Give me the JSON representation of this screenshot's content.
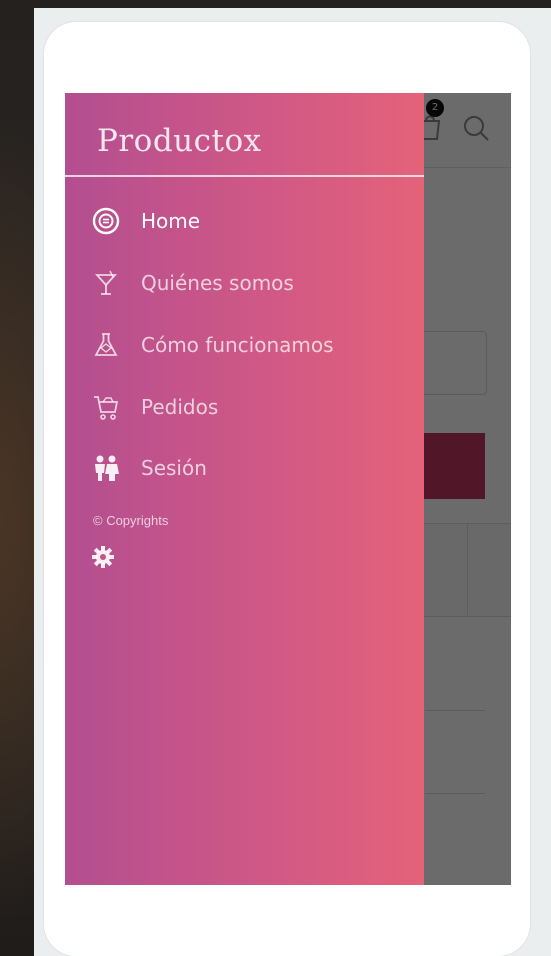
{
  "app": {
    "title": "Productox",
    "cart_count": "2"
  },
  "drawer": {
    "items": [
      {
        "label": "Home",
        "icon": "home-circle-icon",
        "active": true
      },
      {
        "label": "Quiénes somos",
        "icon": "cocktail-glass-icon",
        "active": false
      },
      {
        "label": "Cómo funcionamos",
        "icon": "flask-icon",
        "active": false
      },
      {
        "label": "Pedidos",
        "icon": "shopping-cart-icon",
        "active": false
      },
      {
        "label": "Sesión",
        "icon": "couple-icon",
        "active": false
      }
    ],
    "copyright": "© Copyrights",
    "settings_icon": "gear-icon"
  },
  "colors": {
    "drawer_gradient_start": "#b34e90",
    "drawer_gradient_end": "#e4627a",
    "accent": "#c2385f"
  }
}
